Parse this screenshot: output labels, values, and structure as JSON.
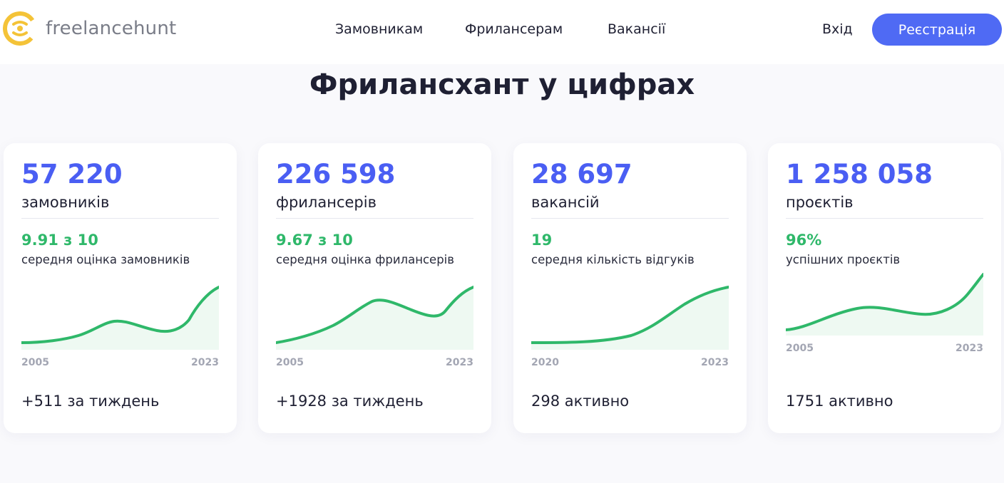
{
  "header": {
    "brand": "freelancehunt",
    "nav": [
      "Замовникам",
      "Фрилансерам",
      "Вакансії"
    ],
    "login_label": "Вхід",
    "register_label": "Реєстрація",
    "accent_color": "#4f6af4",
    "logo_color": "#f4c338"
  },
  "page": {
    "title": "Фрилансхант у цифрах"
  },
  "cards": [
    {
      "big_number": "57 220",
      "big_label": "замовників",
      "rating": "9.91 з 10",
      "rating_label": "середня оцінка замовників",
      "year_start": "2005",
      "year_end": "2023",
      "footer": "+511 за тиждень"
    },
    {
      "big_number": "226 598",
      "big_label": "фрилансерів",
      "rating": "9.67 з 10",
      "rating_label": "середня оцінка фрилансерів",
      "year_start": "2005",
      "year_end": "2023",
      "footer": "+1928 за тиждень"
    },
    {
      "big_number": "28 697",
      "big_label": "вакансій",
      "rating": "19",
      "rating_label": "середня кількість відгуків",
      "year_start": "2020",
      "year_end": "2023",
      "footer": "298 активно"
    },
    {
      "big_number": "1 258 058",
      "big_label": "проєктів",
      "rating": "96%",
      "rating_label": "успішних проєктів",
      "year_start": "2005",
      "year_end": "2023",
      "footer": "1751 активно"
    }
  ],
  "colors": {
    "number": "#4a5ef3",
    "rating": "#2fb86a",
    "trend_line": "#2fb86a",
    "trend_fill": "#eef9f2"
  }
}
